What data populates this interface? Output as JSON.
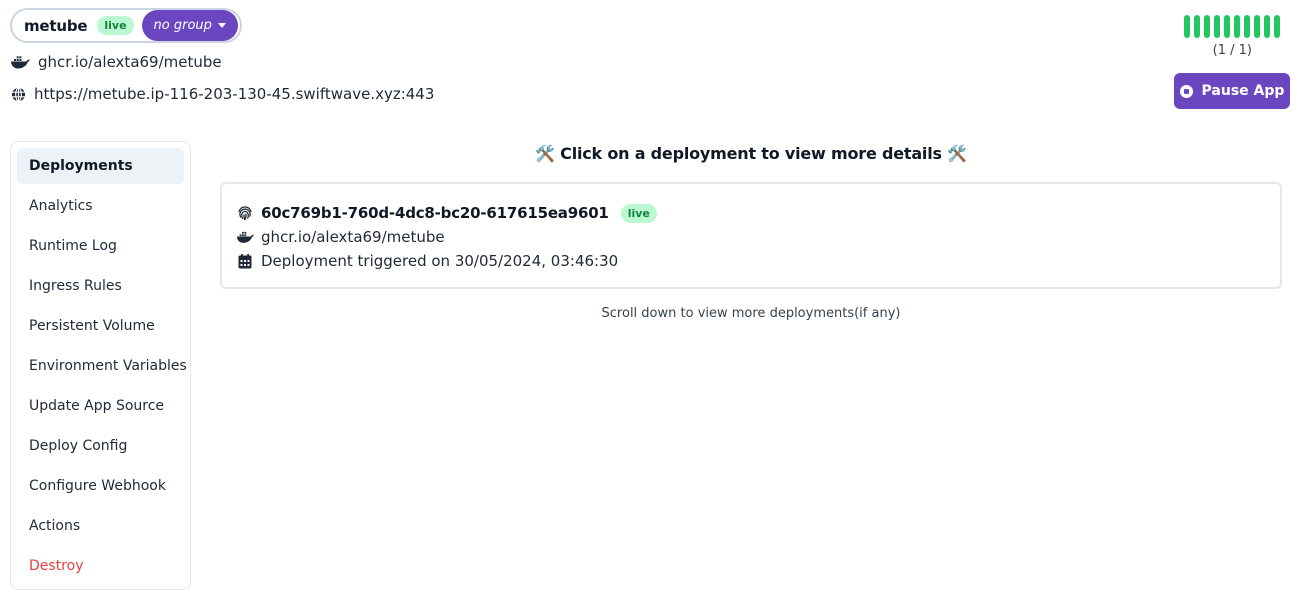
{
  "app": {
    "name": "metube",
    "status_badge": "live",
    "group_label": "no group",
    "image": "ghcr.io/alexta69/metube",
    "url": "https://metube.ip-116-203-130-45.swiftwave.xyz:443"
  },
  "status": {
    "replicas_running": 1,
    "replicas_total": 1,
    "bar_count": 10,
    "bar_color": "#22c55e",
    "count_text": "(1 / 1)"
  },
  "actions": {
    "pause_label": "Pause App"
  },
  "sidebar": {
    "items": [
      {
        "label": "Deployments",
        "active": true
      },
      {
        "label": "Analytics"
      },
      {
        "label": "Runtime Log"
      },
      {
        "label": "Ingress Rules"
      },
      {
        "label": "Persistent Volume"
      },
      {
        "label": "Environment Variables"
      },
      {
        "label": "Update App Source"
      },
      {
        "label": "Deploy Config"
      },
      {
        "label": "Configure Webhook"
      },
      {
        "label": "Actions"
      },
      {
        "label": "Destroy",
        "danger": true
      }
    ]
  },
  "main": {
    "title": "🛠️ Click on a deployment to view more details 🛠️",
    "deployments": [
      {
        "id": "60c769b1-760d-4dc8-bc20-617615ea9601",
        "status_badge": "live",
        "image": "ghcr.io/alexta69/metube",
        "triggered_text": "Deployment triggered on 30/05/2024, 03:46:30"
      }
    ],
    "scroll_hint": "Scroll down to view more deployments(if any)"
  },
  "colors": {
    "accent": "#6b46c1",
    "live_bg": "#bbf7d0",
    "live_text": "#15803d",
    "danger": "#e53e3e",
    "active_item_bg": "#edf2f7"
  }
}
